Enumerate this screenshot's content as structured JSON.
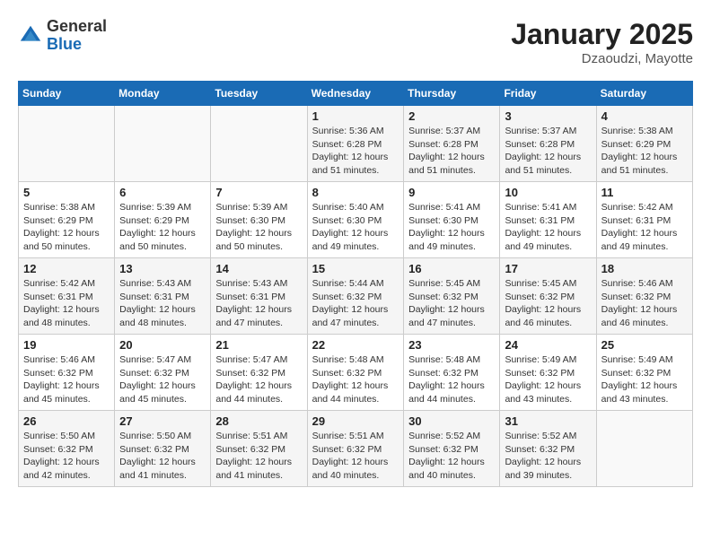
{
  "header": {
    "logo_general": "General",
    "logo_blue": "Blue",
    "month_title": "January 2025",
    "location": "Dzaoudzi, Mayotte"
  },
  "weekdays": [
    "Sunday",
    "Monday",
    "Tuesday",
    "Wednesday",
    "Thursday",
    "Friday",
    "Saturday"
  ],
  "weeks": [
    [
      {
        "day": "",
        "sunrise": "",
        "sunset": "",
        "daylight": ""
      },
      {
        "day": "",
        "sunrise": "",
        "sunset": "",
        "daylight": ""
      },
      {
        "day": "",
        "sunrise": "",
        "sunset": "",
        "daylight": ""
      },
      {
        "day": "1",
        "sunrise": "Sunrise: 5:36 AM",
        "sunset": "Sunset: 6:28 PM",
        "daylight": "Daylight: 12 hours and 51 minutes."
      },
      {
        "day": "2",
        "sunrise": "Sunrise: 5:37 AM",
        "sunset": "Sunset: 6:28 PM",
        "daylight": "Daylight: 12 hours and 51 minutes."
      },
      {
        "day": "3",
        "sunrise": "Sunrise: 5:37 AM",
        "sunset": "Sunset: 6:28 PM",
        "daylight": "Daylight: 12 hours and 51 minutes."
      },
      {
        "day": "4",
        "sunrise": "Sunrise: 5:38 AM",
        "sunset": "Sunset: 6:29 PM",
        "daylight": "Daylight: 12 hours and 51 minutes."
      }
    ],
    [
      {
        "day": "5",
        "sunrise": "Sunrise: 5:38 AM",
        "sunset": "Sunset: 6:29 PM",
        "daylight": "Daylight: 12 hours and 50 minutes."
      },
      {
        "day": "6",
        "sunrise": "Sunrise: 5:39 AM",
        "sunset": "Sunset: 6:29 PM",
        "daylight": "Daylight: 12 hours and 50 minutes."
      },
      {
        "day": "7",
        "sunrise": "Sunrise: 5:39 AM",
        "sunset": "Sunset: 6:30 PM",
        "daylight": "Daylight: 12 hours and 50 minutes."
      },
      {
        "day": "8",
        "sunrise": "Sunrise: 5:40 AM",
        "sunset": "Sunset: 6:30 PM",
        "daylight": "Daylight: 12 hours and 49 minutes."
      },
      {
        "day": "9",
        "sunrise": "Sunrise: 5:41 AM",
        "sunset": "Sunset: 6:30 PM",
        "daylight": "Daylight: 12 hours and 49 minutes."
      },
      {
        "day": "10",
        "sunrise": "Sunrise: 5:41 AM",
        "sunset": "Sunset: 6:31 PM",
        "daylight": "Daylight: 12 hours and 49 minutes."
      },
      {
        "day": "11",
        "sunrise": "Sunrise: 5:42 AM",
        "sunset": "Sunset: 6:31 PM",
        "daylight": "Daylight: 12 hours and 49 minutes."
      }
    ],
    [
      {
        "day": "12",
        "sunrise": "Sunrise: 5:42 AM",
        "sunset": "Sunset: 6:31 PM",
        "daylight": "Daylight: 12 hours and 48 minutes."
      },
      {
        "day": "13",
        "sunrise": "Sunrise: 5:43 AM",
        "sunset": "Sunset: 6:31 PM",
        "daylight": "Daylight: 12 hours and 48 minutes."
      },
      {
        "day": "14",
        "sunrise": "Sunrise: 5:43 AM",
        "sunset": "Sunset: 6:31 PM",
        "daylight": "Daylight: 12 hours and 47 minutes."
      },
      {
        "day": "15",
        "sunrise": "Sunrise: 5:44 AM",
        "sunset": "Sunset: 6:32 PM",
        "daylight": "Daylight: 12 hours and 47 minutes."
      },
      {
        "day": "16",
        "sunrise": "Sunrise: 5:45 AM",
        "sunset": "Sunset: 6:32 PM",
        "daylight": "Daylight: 12 hours and 47 minutes."
      },
      {
        "day": "17",
        "sunrise": "Sunrise: 5:45 AM",
        "sunset": "Sunset: 6:32 PM",
        "daylight": "Daylight: 12 hours and 46 minutes."
      },
      {
        "day": "18",
        "sunrise": "Sunrise: 5:46 AM",
        "sunset": "Sunset: 6:32 PM",
        "daylight": "Daylight: 12 hours and 46 minutes."
      }
    ],
    [
      {
        "day": "19",
        "sunrise": "Sunrise: 5:46 AM",
        "sunset": "Sunset: 6:32 PM",
        "daylight": "Daylight: 12 hours and 45 minutes."
      },
      {
        "day": "20",
        "sunrise": "Sunrise: 5:47 AM",
        "sunset": "Sunset: 6:32 PM",
        "daylight": "Daylight: 12 hours and 45 minutes."
      },
      {
        "day": "21",
        "sunrise": "Sunrise: 5:47 AM",
        "sunset": "Sunset: 6:32 PM",
        "daylight": "Daylight: 12 hours and 44 minutes."
      },
      {
        "day": "22",
        "sunrise": "Sunrise: 5:48 AM",
        "sunset": "Sunset: 6:32 PM",
        "daylight": "Daylight: 12 hours and 44 minutes."
      },
      {
        "day": "23",
        "sunrise": "Sunrise: 5:48 AM",
        "sunset": "Sunset: 6:32 PM",
        "daylight": "Daylight: 12 hours and 44 minutes."
      },
      {
        "day": "24",
        "sunrise": "Sunrise: 5:49 AM",
        "sunset": "Sunset: 6:32 PM",
        "daylight": "Daylight: 12 hours and 43 minutes."
      },
      {
        "day": "25",
        "sunrise": "Sunrise: 5:49 AM",
        "sunset": "Sunset: 6:32 PM",
        "daylight": "Daylight: 12 hours and 43 minutes."
      }
    ],
    [
      {
        "day": "26",
        "sunrise": "Sunrise: 5:50 AM",
        "sunset": "Sunset: 6:32 PM",
        "daylight": "Daylight: 12 hours and 42 minutes."
      },
      {
        "day": "27",
        "sunrise": "Sunrise: 5:50 AM",
        "sunset": "Sunset: 6:32 PM",
        "daylight": "Daylight: 12 hours and 41 minutes."
      },
      {
        "day": "28",
        "sunrise": "Sunrise: 5:51 AM",
        "sunset": "Sunset: 6:32 PM",
        "daylight": "Daylight: 12 hours and 41 minutes."
      },
      {
        "day": "29",
        "sunrise": "Sunrise: 5:51 AM",
        "sunset": "Sunset: 6:32 PM",
        "daylight": "Daylight: 12 hours and 40 minutes."
      },
      {
        "day": "30",
        "sunrise": "Sunrise: 5:52 AM",
        "sunset": "Sunset: 6:32 PM",
        "daylight": "Daylight: 12 hours and 40 minutes."
      },
      {
        "day": "31",
        "sunrise": "Sunrise: 5:52 AM",
        "sunset": "Sunset: 6:32 PM",
        "daylight": "Daylight: 12 hours and 39 minutes."
      },
      {
        "day": "",
        "sunrise": "",
        "sunset": "",
        "daylight": ""
      }
    ]
  ]
}
